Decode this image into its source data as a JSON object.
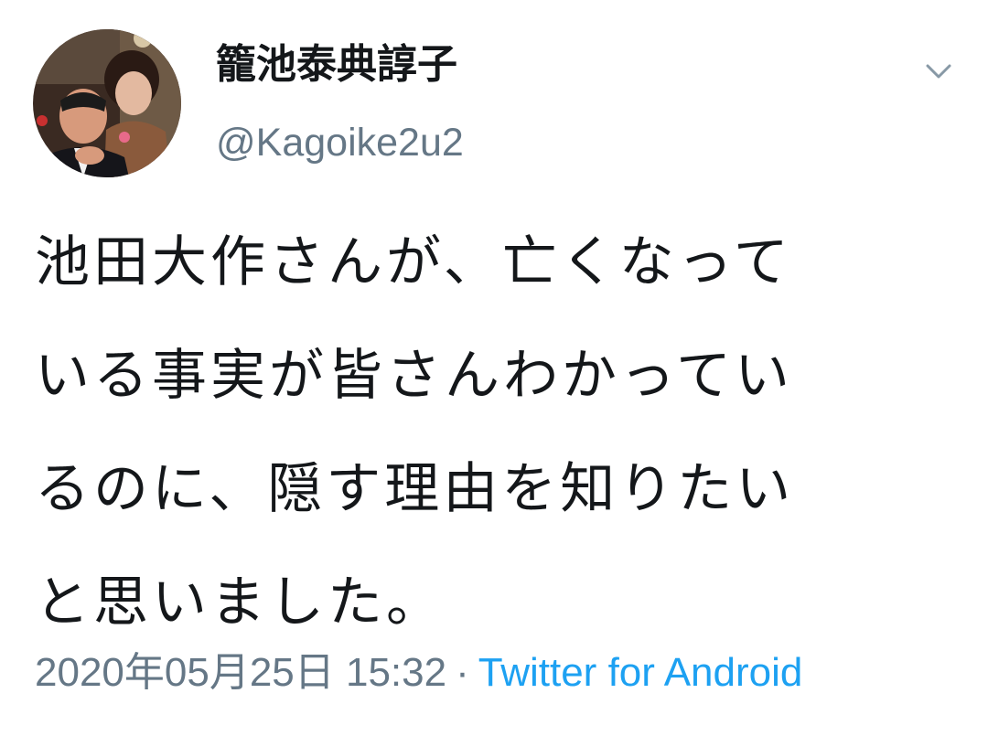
{
  "tweet": {
    "author": {
      "display_name": "籠池泰典諄子",
      "handle": "@Kagoike2u2"
    },
    "body_lines": [
      "池田大作さんが、亡くなって",
      "いる事実が皆さんわかってい",
      "るのに、隠す理由を知りたい",
      "と思いました。"
    ],
    "meta": {
      "timestamp": "2020年05月25日 15:32",
      "separator": "·",
      "source": "Twitter for Android"
    }
  },
  "icons": {
    "menu_caret": "chevron-down-icon",
    "avatar": "user-avatar"
  },
  "colors": {
    "text_primary": "#14171a",
    "text_secondary": "#657786",
    "link": "#1da1f2",
    "background": "#ffffff"
  }
}
